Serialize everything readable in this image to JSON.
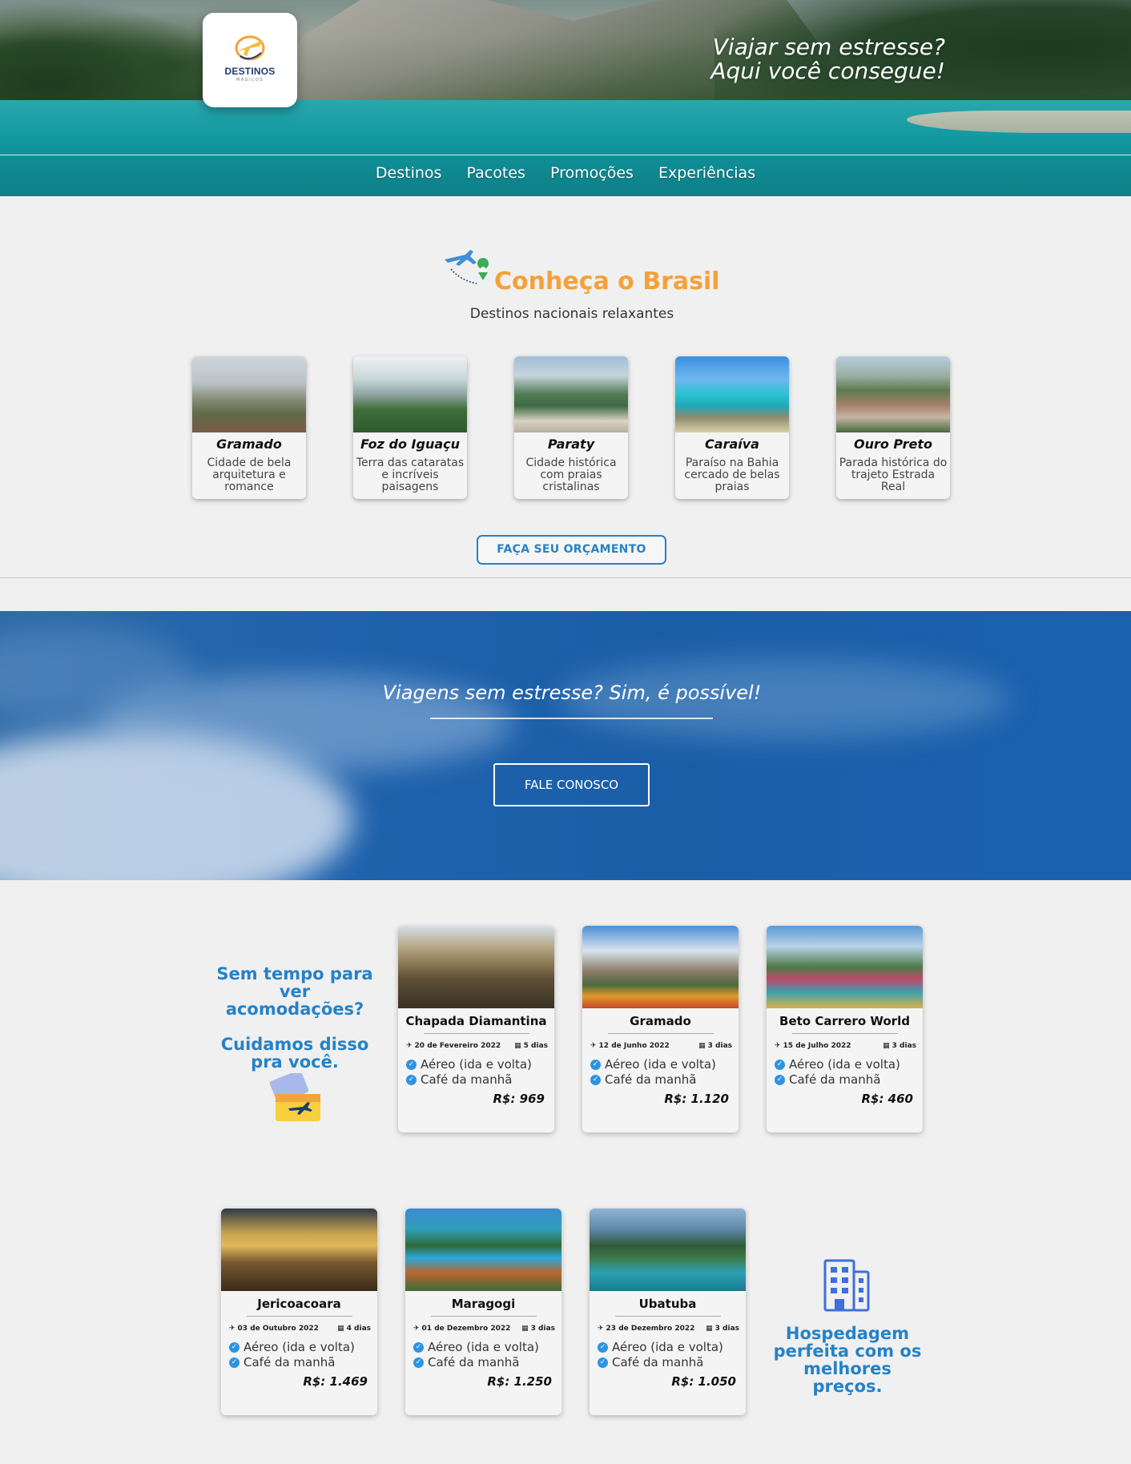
{
  "header": {
    "logo_name": "DESTINOS",
    "logo_sub": "MÁGICOS",
    "tagline_line1": "Viajar sem estresse?",
    "tagline_line2": "Aqui você consegue!",
    "nav": [
      "Destinos",
      "Pacotes",
      "Promoções",
      "Experiências"
    ]
  },
  "section_brasil": {
    "title": "Conheça o Brasil",
    "subtitle": "Destinos nacionais relaxantes",
    "destinations": [
      {
        "name": "Gramado",
        "desc": "Cidade de bela arquitetura e romance"
      },
      {
        "name": "Foz do Iguaçu",
        "desc": "Terra das cataratas e incríveis paisagens"
      },
      {
        "name": "Paraty",
        "desc": "Cidade histórica com praias cristalinas"
      },
      {
        "name": "Caraíva",
        "desc": "Paraíso na Bahia cercado de belas praias"
      },
      {
        "name": "Ouro Preto",
        "desc": "Parada histórica do trajeto Estrada Real"
      }
    ],
    "quote_button": "FAÇA SEU ORÇAMENTO"
  },
  "banner": {
    "text": "Viagens sem estresse? Sim, é possível!",
    "button": "FALE CONOSCO"
  },
  "accommodations": {
    "side_line1": "Sem tempo para ver acomodações?",
    "side_line2": "Cuidamos disso pra você.",
    "side_bottom": "Hospedagem perfeita com os melhores preços.",
    "feature1": "Aéreo (ida e volta)",
    "feature2": "Café da manhã",
    "packages": [
      {
        "name": "Chapada Diamantina",
        "date": "20 de Fevereiro 2022",
        "days": "5 dias",
        "price": "R$: 969"
      },
      {
        "name": "Gramado",
        "date": "12 de Junho 2022",
        "days": "3 dias",
        "price": "R$: 1.120"
      },
      {
        "name": "Beto Carrero World",
        "date": "15 de Julho 2022",
        "days": "3 dias",
        "price": "R$: 460"
      },
      {
        "name": "Jericoacoara",
        "date": "03 de Outubro 2022",
        "days": "4 dias",
        "price": "R$: 1.469"
      },
      {
        "name": "Maragogi",
        "date": "01 de Dezembro 2022",
        "days": "3 dias",
        "price": "R$: 1.250"
      },
      {
        "name": "Ubatuba",
        "date": "23 de Dezembro 2022",
        "days": "3 dias",
        "price": "R$: 1.050"
      }
    ]
  },
  "colors": {
    "accent_blue": "#2582c6",
    "accent_orange": "#f4a13a",
    "banner_blue": "#1a5ea8"
  }
}
